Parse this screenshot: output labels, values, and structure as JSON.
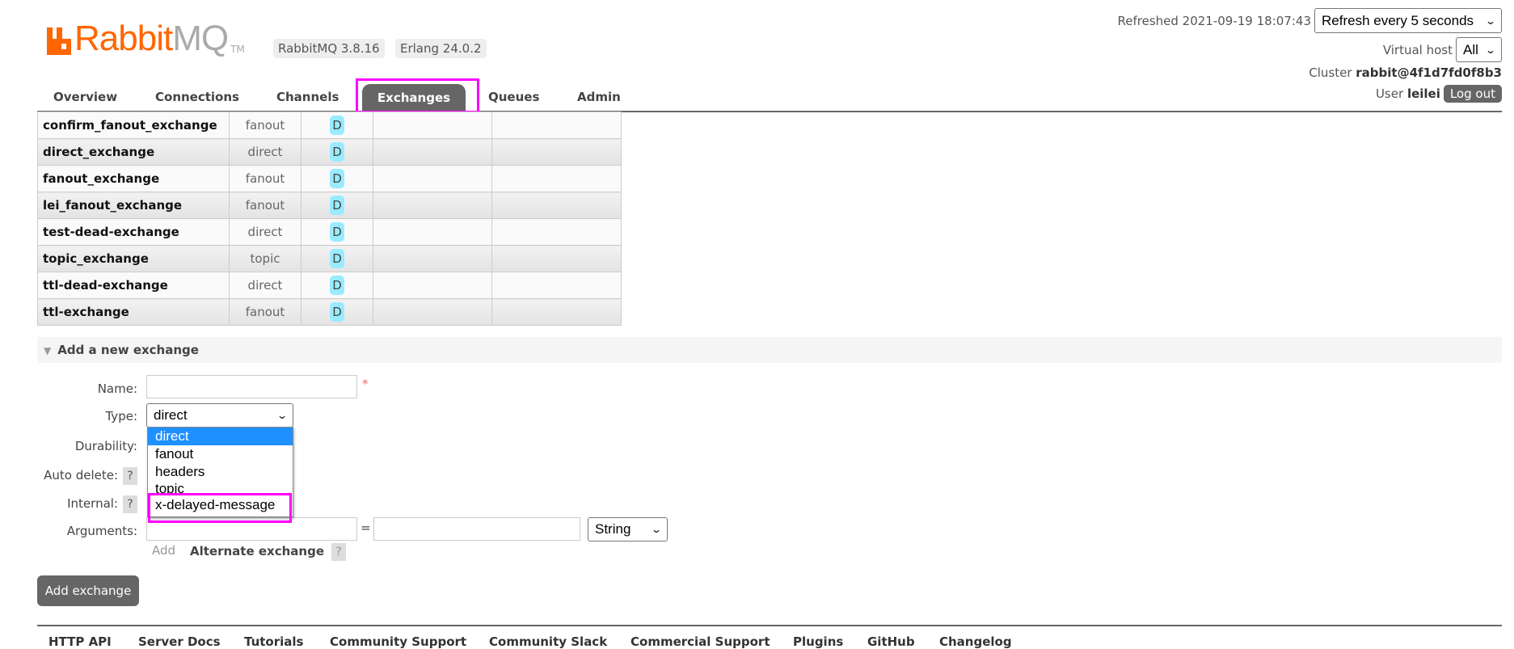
{
  "header": {
    "logo_text_left": "Rabbit",
    "logo_text_right": "MQ",
    "logo_tm": "TM",
    "rabbitmq_version": "RabbitMQ 3.8.16",
    "erlang_version": "Erlang 24.0.2",
    "refreshed": "Refreshed 2021-09-19 18:07:43",
    "refresh_select": "Refresh every 5 seconds",
    "vhost_label": "Virtual host",
    "vhost_value": "All",
    "cluster_label": "Cluster",
    "cluster_name": "rabbit@4f1d7fd0f8b3",
    "user_label": "User",
    "user_name": "leilei",
    "logout": "Log out"
  },
  "nav": {
    "tabs": [
      "Overview",
      "Connections",
      "Channels",
      "Exchanges",
      "Queues",
      "Admin"
    ],
    "active": "Exchanges"
  },
  "exchanges": [
    {
      "name": "confirm_fanout_exchange",
      "type": "fanout",
      "features": "D"
    },
    {
      "name": "direct_exchange",
      "type": "direct",
      "features": "D"
    },
    {
      "name": "fanout_exchange",
      "type": "fanout",
      "features": "D"
    },
    {
      "name": "lei_fanout_exchange",
      "type": "fanout",
      "features": "D"
    },
    {
      "name": "test-dead-exchange",
      "type": "direct",
      "features": "D"
    },
    {
      "name": "topic_exchange",
      "type": "topic",
      "features": "D"
    },
    {
      "name": "ttl-dead-exchange",
      "type": "direct",
      "features": "D"
    },
    {
      "name": "ttl-exchange",
      "type": "fanout",
      "features": "D"
    }
  ],
  "form": {
    "title": "Add a new exchange",
    "name_label": "Name:",
    "name_value": "",
    "required": "*",
    "type_label": "Type:",
    "type_value": "direct",
    "type_options": [
      "direct",
      "fanout",
      "headers",
      "topic",
      "x-delayed-message"
    ],
    "durability_label": "Durability:",
    "auto_delete_label": "Auto delete:",
    "internal_label": "Internal:",
    "help": "?",
    "arguments_label": "Arguments:",
    "equals": "=",
    "arg_type": "String",
    "add_link": "Add",
    "alternate_exchange": "Alternate exchange",
    "submit": "Add exchange"
  },
  "footer": {
    "links": [
      "HTTP API",
      "Server Docs",
      "Tutorials",
      "Community Support",
      "Community Slack",
      "Commercial Support",
      "Plugins",
      "GitHub",
      "Changelog"
    ]
  },
  "colors": {
    "brand": "#ff6600",
    "highlight": "#ff00ff",
    "selected_option": "#1e90ff",
    "badge": "#99ebff"
  }
}
